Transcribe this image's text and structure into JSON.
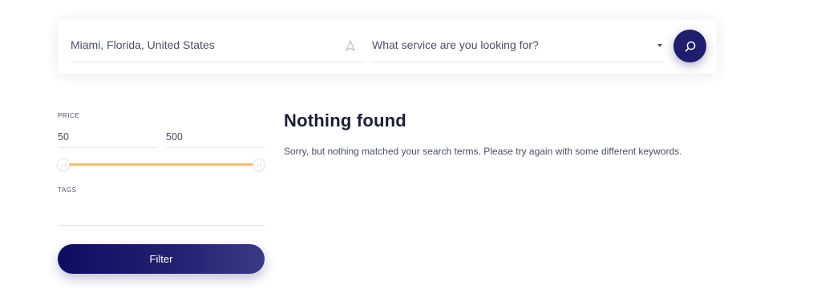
{
  "search": {
    "location_value": "Miami, Florida, United States",
    "service_placeholder": "What service are you looking for?",
    "search_icon": "search-icon",
    "locate_icon": "location-arrow-icon"
  },
  "filters": {
    "price_label": "PRICE",
    "price_min": "50",
    "price_max": "500",
    "tags_label": "TAGS",
    "filter_label": "Filter",
    "accent_color": "#edc078",
    "button_color": "#1f1d6e"
  },
  "results": {
    "title": "Nothing found",
    "message": "Sorry, but nothing matched your search terms. Please try again with some different keywords."
  }
}
